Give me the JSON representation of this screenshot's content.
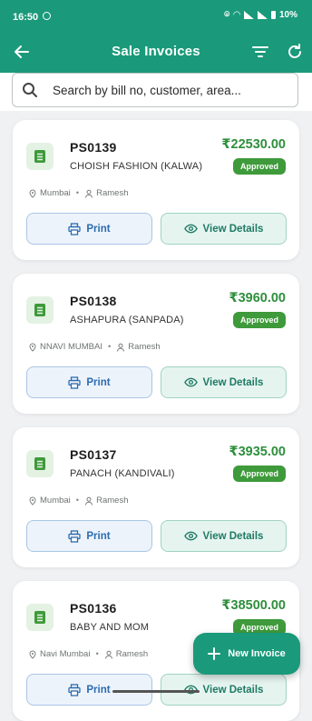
{
  "status_bar": {
    "time": "16:50",
    "battery": "10%"
  },
  "header": {
    "title": "Sale Invoices"
  },
  "search": {
    "placeholder": "Search by bill no, customer, area..."
  },
  "invoices": [
    {
      "number": "PS0139",
      "customer": "CHOISH FASHION (KALWA)",
      "amount": "₹22530.00",
      "status": "Approved",
      "area": "Mumbai",
      "salesperson": "Ramesh",
      "print_label": "Print",
      "view_label": "View Details"
    },
    {
      "number": "PS0138",
      "customer": "ASHAPURA (SANPADA)",
      "amount": "₹3960.00",
      "status": "Approved",
      "area": "NNAVI MUMBAI",
      "salesperson": "Ramesh",
      "print_label": "Print",
      "view_label": "View Details"
    },
    {
      "number": "PS0137",
      "customer": "PANACH (KANDIVALI)",
      "amount": "₹3935.00",
      "status": "Approved",
      "area": "Mumbai",
      "salesperson": "Ramesh",
      "print_label": "Print",
      "view_label": "View Details"
    },
    {
      "number": "PS0136",
      "customer": "BABY AND MOM",
      "amount": "₹38500.00",
      "status": "Approved",
      "area": "Navi Mumbai",
      "salesperson": "Ramesh",
      "print_label": "Print",
      "view_label": "View Details"
    }
  ],
  "fab": {
    "label": "New Invoice"
  },
  "colors": {
    "primary": "#1a9a7a",
    "amount": "#2e8f3c",
    "status": "#3e9a3a",
    "print": "#2b6cb0"
  },
  "icons": {
    "back": "arrow-left-icon",
    "filter": "filter-icon",
    "refresh": "refresh-icon",
    "search": "search-icon",
    "document": "document-icon",
    "location": "location-pin-icon",
    "person": "person-icon",
    "print": "printer-icon",
    "view": "eye-icon",
    "add": "plus-icon"
  }
}
